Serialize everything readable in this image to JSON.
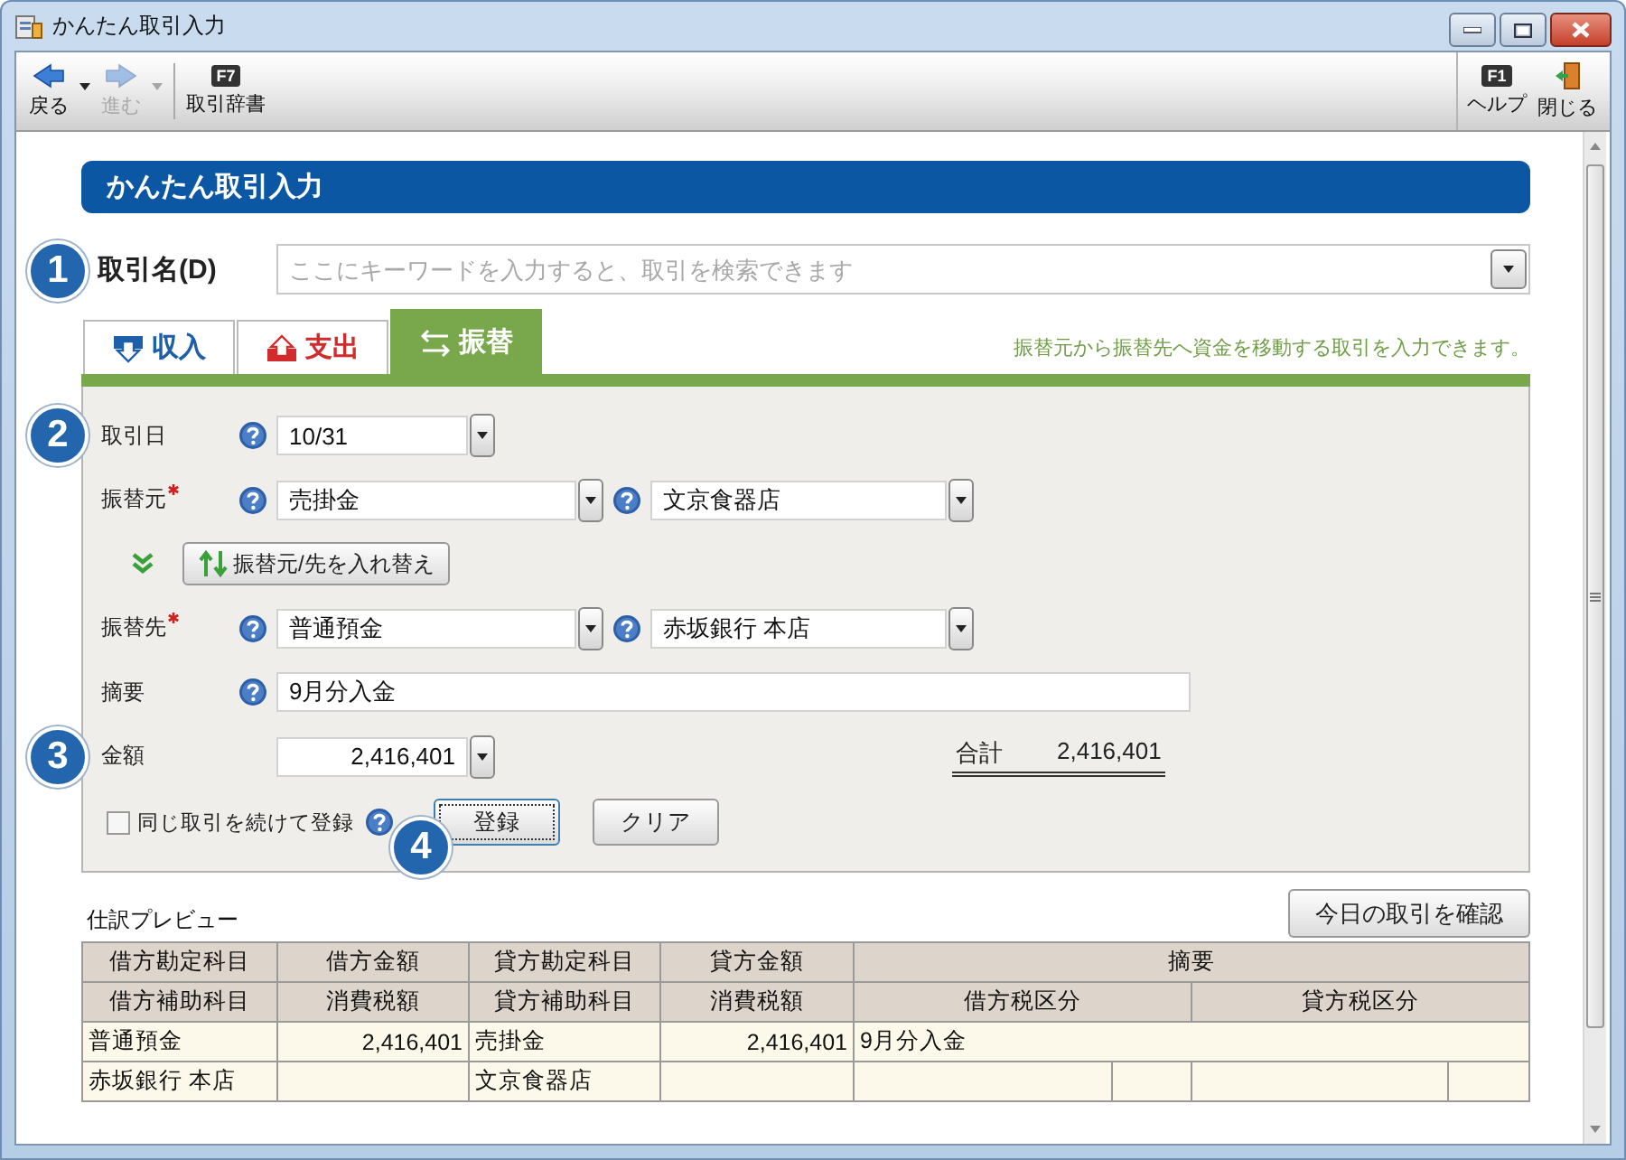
{
  "window": {
    "title": "かんたん取引入力"
  },
  "toolbar": {
    "left": [
      {
        "kind": "back",
        "label": "戻る",
        "disabled": false,
        "menu": true
      },
      {
        "kind": "forward",
        "label": "進む",
        "disabled": true,
        "menu": true
      },
      {
        "kind": "key",
        "key": "F7",
        "label": "取引辞書",
        "disabled": false,
        "menu": false
      }
    ],
    "right": [
      {
        "kind": "key",
        "key": "F1",
        "label": "ヘルプ",
        "disabled": false,
        "menu": false
      },
      {
        "kind": "exit",
        "label": "閉じる",
        "disabled": false,
        "menu": false
      }
    ]
  },
  "header": {
    "title": "かんたん取引入力"
  },
  "search": {
    "label": "取引名(D)",
    "placeholder": "ここにキーワードを入力すると、取引を検索できます",
    "callout": "1"
  },
  "tabs": [
    {
      "kind": "income",
      "label": "収入",
      "selected": false
    },
    {
      "kind": "expense",
      "label": "支出",
      "selected": false
    },
    {
      "kind": "transfer",
      "label": "振替",
      "selected": true
    }
  ],
  "tab_hint": "振替元から振替先へ資金を移動する取引を入力できます。",
  "form": {
    "rows": [
      {
        "kind": "date",
        "label": "取引日",
        "required": false,
        "callout": "2",
        "fields": [
          {
            "value": "10/31",
            "help": true,
            "dropdown": true
          }
        ]
      },
      {
        "kind": "account",
        "label": "振替元",
        "required": true,
        "fields": [
          {
            "value": "売掛金",
            "help": true,
            "dropdown": true
          },
          {
            "value": "文京食器店",
            "help": true,
            "dropdown": true
          }
        ]
      },
      {
        "kind": "swap",
        "label": "振替元/先を入れ替え"
      },
      {
        "kind": "account",
        "label": "振替先",
        "required": true,
        "fields": [
          {
            "value": "普通預金",
            "help": true,
            "dropdown": true
          },
          {
            "value": "赤坂銀行 本店",
            "help": true,
            "dropdown": true
          }
        ]
      },
      {
        "kind": "memo",
        "label": "摘要",
        "required": false,
        "fields": [
          {
            "value": "9月分入金",
            "help": true,
            "dropdown": false
          }
        ]
      },
      {
        "kind": "amount",
        "label": "金額",
        "required": false,
        "callout": "3",
        "fields": [
          {
            "value": "2,416,401",
            "help": false,
            "dropdown": true
          }
        ],
        "total": {
          "label": "合計",
          "value": "2,416,401"
        }
      }
    ],
    "repeat": {
      "label": "同じ取引を続けて登録",
      "checked": false,
      "help": true
    },
    "buttons": [
      {
        "label": "登録",
        "focused": true,
        "callout": "4"
      },
      {
        "label": "クリア",
        "focused": false
      }
    ]
  },
  "preview": {
    "title": "仕訳プレビュー",
    "button": "今日の取引を確認",
    "table": {
      "header_rows": [
        [
          "借方勘定科目",
          "借方金額",
          "貸方勘定科目",
          "貸方金額",
          "摘要"
        ],
        [
          "借方補助科目",
          "消費税額",
          "貸方補助科目",
          "消費税額",
          "借方税区分",
          "貸方税区分"
        ]
      ],
      "rows": [
        [
          "普通預金",
          "2,416,401",
          "売掛金",
          "2,416,401",
          "9月分入金"
        ],
        [
          "赤坂銀行 本店",
          null,
          "文京食器店",
          null,
          null,
          null,
          null,
          null
        ]
      ]
    }
  }
}
